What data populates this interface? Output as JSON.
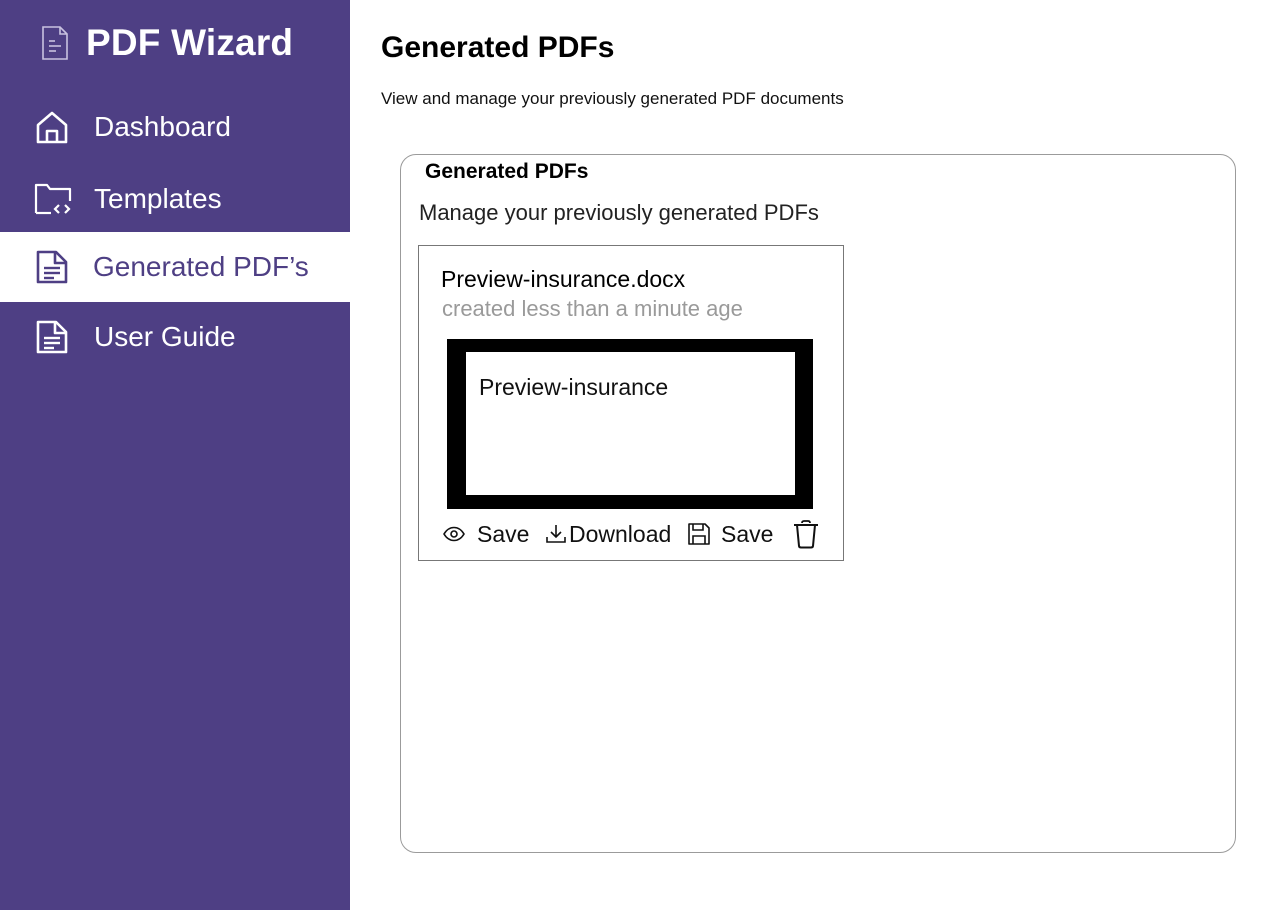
{
  "brand": {
    "title": "PDF Wizard",
    "icon": "document-icon"
  },
  "sidebar": {
    "items": [
      {
        "label": "Dashboard",
        "icon": "home-icon",
        "active": false
      },
      {
        "label": "Templates",
        "icon": "folder-code-icon",
        "active": false
      },
      {
        "label": "Generated PDF’s",
        "icon": "document-text-icon",
        "active": true
      },
      {
        "label": "User Guide",
        "icon": "document-text-icon",
        "active": false
      }
    ]
  },
  "main": {
    "title": "Generated PDFs",
    "subtitle": "View and manage your previously generated PDF documents",
    "panel": {
      "title": "Generated PDFs",
      "description": "Manage your previously generated PDFs",
      "cards": [
        {
          "filename": "Preview-insurance.docx",
          "created": "created less than a minute age",
          "preview_text": "Preview-insurance",
          "actions": {
            "view_label": "Save",
            "download_label": "Download",
            "save_label": "Save"
          }
        }
      ]
    }
  },
  "colors": {
    "sidebar_bg": "#4e3f84",
    "active_text": "#4e3f84"
  }
}
